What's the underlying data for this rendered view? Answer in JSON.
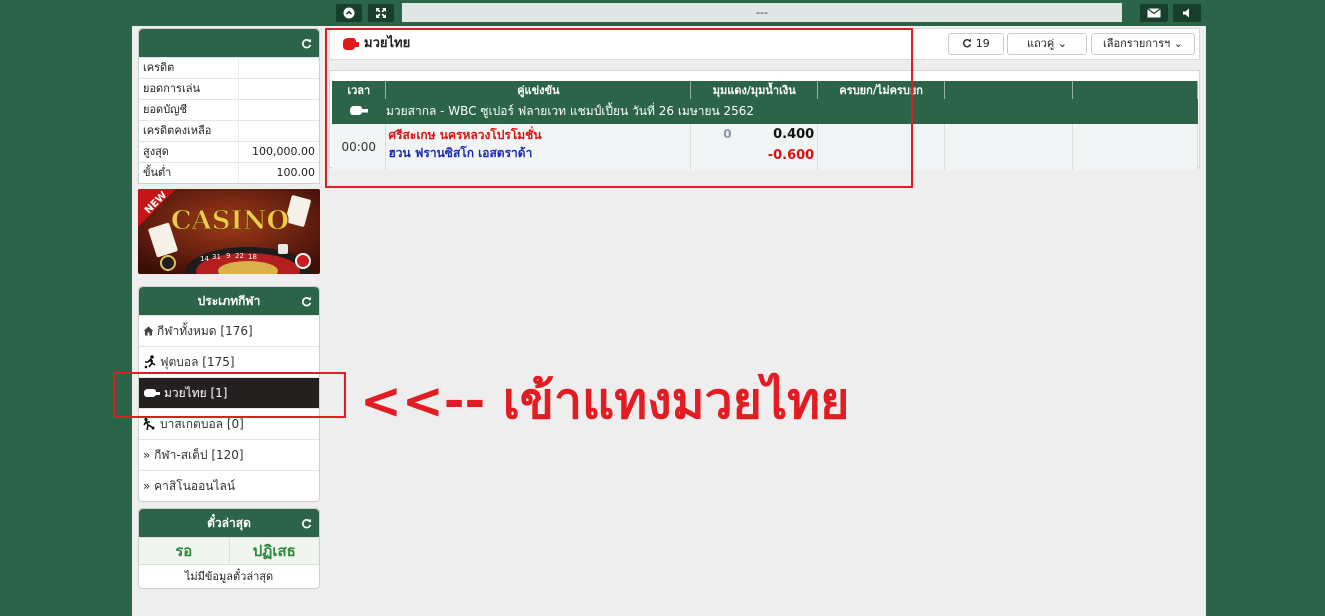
{
  "topbar": {
    "marquee_text": "---",
    "icons": [
      "chevron-up-icon",
      "expand-icon",
      "mail-icon",
      "speaker-icon"
    ]
  },
  "credit": {
    "rows": [
      {
        "label": "เครดิต",
        "value": ""
      },
      {
        "label": "ยอดการเล่น",
        "value": ""
      },
      {
        "label": "ยอดบัญชี",
        "value": ""
      },
      {
        "label": "เครดิตคงเหลือ",
        "value": ""
      },
      {
        "label": "สูงสุด",
        "value": "100,000.00"
      },
      {
        "label": "ขั้นต่ำ",
        "value": "100.00"
      }
    ]
  },
  "banner": {
    "badge": "NEW",
    "title": "CASINO",
    "numbers": [
      "14",
      "31",
      "9",
      "22",
      "18"
    ]
  },
  "sports": {
    "title": "ประเภทกีฬา",
    "items": [
      {
        "label": "กีฬาทั้งหมด [176]",
        "icon": "home-icon"
      },
      {
        "label": "ฟุตบอล [175]",
        "icon": "runner-icon"
      },
      {
        "label": "มวยไทย [1]",
        "icon": "boxing-glove-icon"
      },
      {
        "label": "บาสเกตบอล [0]",
        "icon": "basketball-player-icon"
      },
      {
        "label": "» กีฬา-สเต็ป [120]",
        "icon": ""
      },
      {
        "label": "» คาสิโนออนไลน์",
        "icon": ""
      }
    ]
  },
  "tickets": {
    "title": "ตั๋วล่าสุด",
    "tab_wait": "รอ",
    "tab_reject": "ปฏิเสธ",
    "empty": "ไม่มีข้อมูลตั๋วล่าสุด"
  },
  "main": {
    "title": "มวยไทย",
    "refresh_count": "19",
    "view_label": "แถวคู่",
    "select_label": "เลือกรายการฯ"
  },
  "odds": {
    "headers": [
      "เวลา",
      "คู่แข่งขัน",
      "มุมแดง/มุมน้ำเงิน",
      "ครบยก/ไม่ครบยก",
      "",
      ""
    ],
    "league": "มวยสากล - WBC ซูเปอร์ ฟลายเวท แชมป์เปี้ยน วันที่ 26 เมษายน 2562",
    "match": {
      "time": "00:00",
      "home": "ศรีสะเกษ นครหลวงโปรโมชั่น",
      "away": "ฮวน ฟรานซิสโก เอสตราด้า",
      "hdp": "0",
      "home_odds": "0.400",
      "away_odds": "-0.600"
    }
  },
  "annotation": {
    "text": "<<-- เข้าแทงมวยไทย"
  },
  "colors": {
    "brand_green": "#2b6449",
    "highlight_red": "#e31b23",
    "active_dark": "#24201f"
  }
}
